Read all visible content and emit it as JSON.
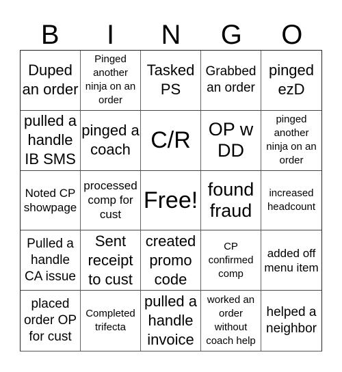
{
  "title_letters": [
    "B",
    "I",
    "N",
    "G",
    "O"
  ],
  "cells": [
    {
      "text": "Duped an order",
      "size": "m"
    },
    {
      "text": "Pinged another ninja on an order",
      "size": "xs"
    },
    {
      "text": "Tasked PS",
      "size": "m"
    },
    {
      "text": "Grabbed an order",
      "size": "ms"
    },
    {
      "text": "pinged ezD",
      "size": "m"
    },
    {
      "text": "pulled a handle IB SMS",
      "size": "m"
    },
    {
      "text": "pinged a coach",
      "size": "m"
    },
    {
      "text": "C/R",
      "size": "xl"
    },
    {
      "text": "OP w DD",
      "size": "l"
    },
    {
      "text": "pinged another ninja on an order",
      "size": "xs"
    },
    {
      "text": "Noted CP showpage",
      "size": "s"
    },
    {
      "text": "processed comp for cust",
      "size": "s"
    },
    {
      "text": "Free!",
      "size": "xl"
    },
    {
      "text": "found fraud",
      "size": "l"
    },
    {
      "text": "increased headcount",
      "size": "xs"
    },
    {
      "text": "Pulled a handle CA issue",
      "size": "ms"
    },
    {
      "text": "Sent receipt to cust",
      "size": "m"
    },
    {
      "text": "created promo code",
      "size": "m"
    },
    {
      "text": "CP confirmed comp",
      "size": "xs"
    },
    {
      "text": "added off menu item",
      "size": "s"
    },
    {
      "text": "placed order OP for cust",
      "size": "ms"
    },
    {
      "text": "Completed trifecta",
      "size": "xs"
    },
    {
      "text": "pulled a handle invoice",
      "size": "m"
    },
    {
      "text": "worked an order without coach help",
      "size": "xs"
    },
    {
      "text": "helped a neighbor",
      "size": "ms"
    }
  ]
}
